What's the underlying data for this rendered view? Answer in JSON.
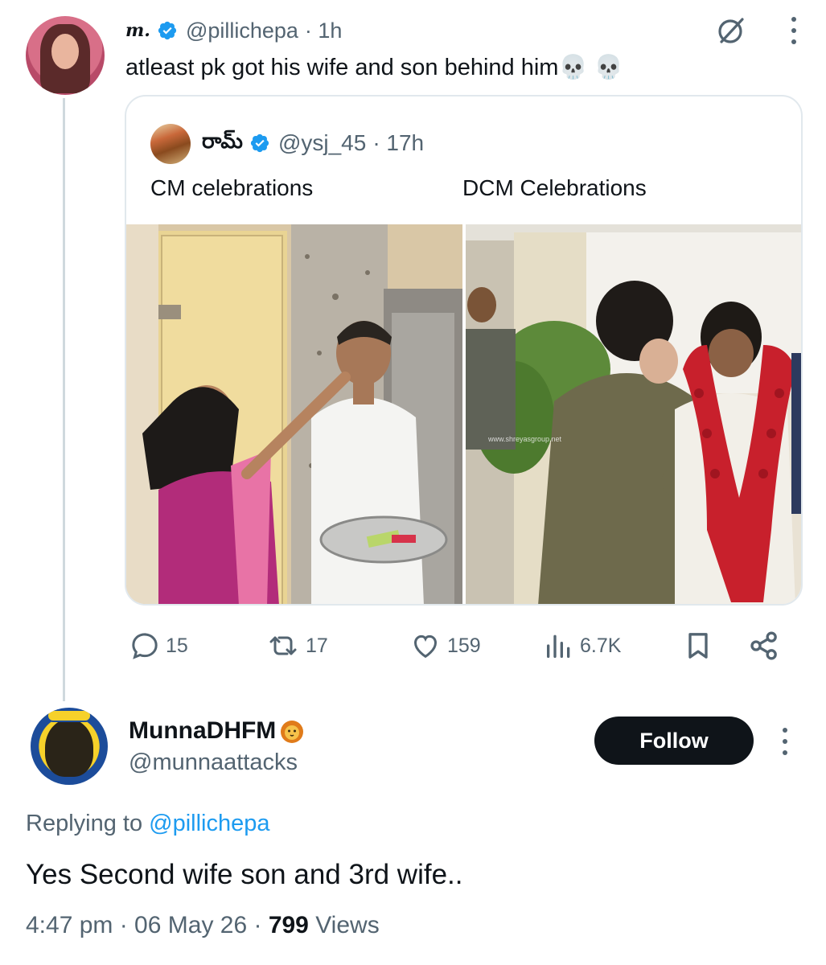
{
  "main_tweet": {
    "display_name": "m.",
    "handle": "@pillichepa",
    "time": "· 1h",
    "text": "atleast pk got his wife and son behind him💀 💀"
  },
  "quoted_tweet": {
    "display_name": "రామ్",
    "handle": "@ysj_45",
    "time": "· 17h",
    "left_caption": "CM celebrations",
    "right_caption": "DCM Celebrations",
    "watermark": "www.shreyasgroup.net"
  },
  "stats": {
    "replies": "15",
    "reposts": "17",
    "likes": "159",
    "views": "6.7K"
  },
  "reply": {
    "display_name": "MunnaDHFM",
    "handle": "@munnaattacks",
    "follow_label": "Follow",
    "replying_prefix": "Replying to ",
    "replying_handle": "@pillichepa",
    "text": "Yes Second wife son and 3rd wife..",
    "time": "4:47 pm · 06 May 26 · ",
    "views_count": "799",
    "views_label": " Views"
  },
  "colors": {
    "accent": "#1d9bf0",
    "text": "#0f1419",
    "secondary": "#536471",
    "border": "#e1e8ed"
  },
  "icons": [
    "verified-icon",
    "grok-icon",
    "more-icon",
    "reply-icon",
    "repost-icon",
    "like-icon",
    "views-icon",
    "bookmark-icon",
    "share-icon",
    "lion-emoji-icon",
    "skull-emoji-icon"
  ]
}
